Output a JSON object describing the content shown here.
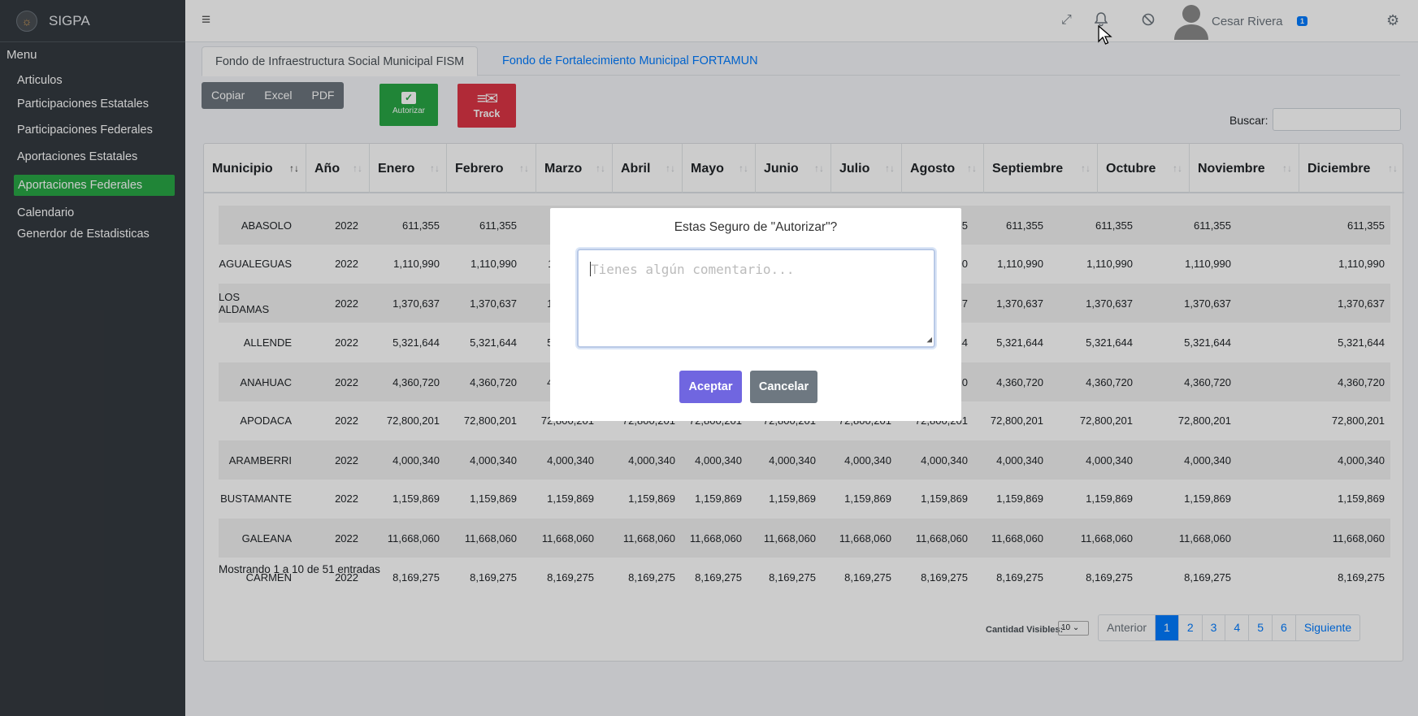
{
  "app": {
    "name": "SIGPA"
  },
  "sidebar": {
    "menu_title": "Menu",
    "items": [
      {
        "label": "Articulos"
      },
      {
        "label": "Participaciones Estatales"
      },
      {
        "label": "Participaciones Federales"
      },
      {
        "label": "Aportaciones Estatales"
      },
      {
        "label": "Aportaciones Federales",
        "active": true
      },
      {
        "label": "Calendario"
      },
      {
        "label": "Generdor de Estadisticas"
      }
    ]
  },
  "topbar": {
    "notification_count": "1",
    "user_name": "Cesar Rivera",
    "icons": [
      "hamburger-icon",
      "fullscreen-icon",
      "bell-icon",
      "block-icon",
      "user-avatar-icon",
      "settings-icon"
    ]
  },
  "tabs": [
    {
      "label": "Fondo de Infraestructura Social Municipal FISM",
      "active": true
    },
    {
      "label": "Fondo de Fortalecimiento Municipal FORTAMUN",
      "active": false
    }
  ],
  "toolbar": {
    "copy": "Copiar",
    "excel": "Excel",
    "pdf": "PDF",
    "authorize": "Autorizar",
    "track": "Track",
    "search_label": "Buscar:"
  },
  "table": {
    "columns": [
      "Municipio",
      "Año",
      "Enero",
      "Febrero",
      "Marzo",
      "Abril",
      "Mayo",
      "Junio",
      "Julio",
      "Agosto",
      "Septiembre",
      "Octubre",
      "Noviembre",
      "Diciembre"
    ],
    "rows": [
      {
        "municipio": "ABASOLO",
        "anio": "2022",
        "valor": "611,355"
      },
      {
        "municipio": "AGUALEGUAS",
        "anio": "2022",
        "valor": "1,110,990"
      },
      {
        "municipio": "LOS ALDAMAS",
        "anio": "2022",
        "valor": "1,370,637"
      },
      {
        "municipio": "ALLENDE",
        "anio": "2022",
        "valor": "5,321,644"
      },
      {
        "municipio": "ANAHUAC",
        "anio": "2022",
        "valor": "4,360,720"
      },
      {
        "municipio": "APODACA",
        "anio": "2022",
        "valor": "72,800,201"
      },
      {
        "municipio": "ARAMBERRI",
        "anio": "2022",
        "valor": "4,000,340"
      },
      {
        "municipio": "BUSTAMANTE",
        "anio": "2022",
        "valor": "1,159,869"
      },
      {
        "municipio": "GALEANA",
        "anio": "2022",
        "valor": "11,668,060"
      },
      {
        "municipio": "CARMEN",
        "anio": "2022",
        "valor": "8,169,275"
      }
    ],
    "info": "Mostrando 1 a 10 de 51 entradas",
    "visibles_label": "Cantidad Visibles:",
    "visibles_value": "10",
    "pagination": [
      "Anterior",
      "1",
      "2",
      "3",
      "4",
      "5",
      "6",
      "Siguiente"
    ],
    "current_page": "1"
  },
  "modal": {
    "title": "Estas Seguro de \"Autorizar\"?",
    "placeholder": "Tienes algún comentario...",
    "accept": "Aceptar",
    "cancel": "Cancelar"
  },
  "colors": {
    "sidebar_bg": "#343a40",
    "active_green": "#28a745",
    "track_red": "#dc3545",
    "primary": "#007bff",
    "accept_purple": "#7066e0"
  }
}
